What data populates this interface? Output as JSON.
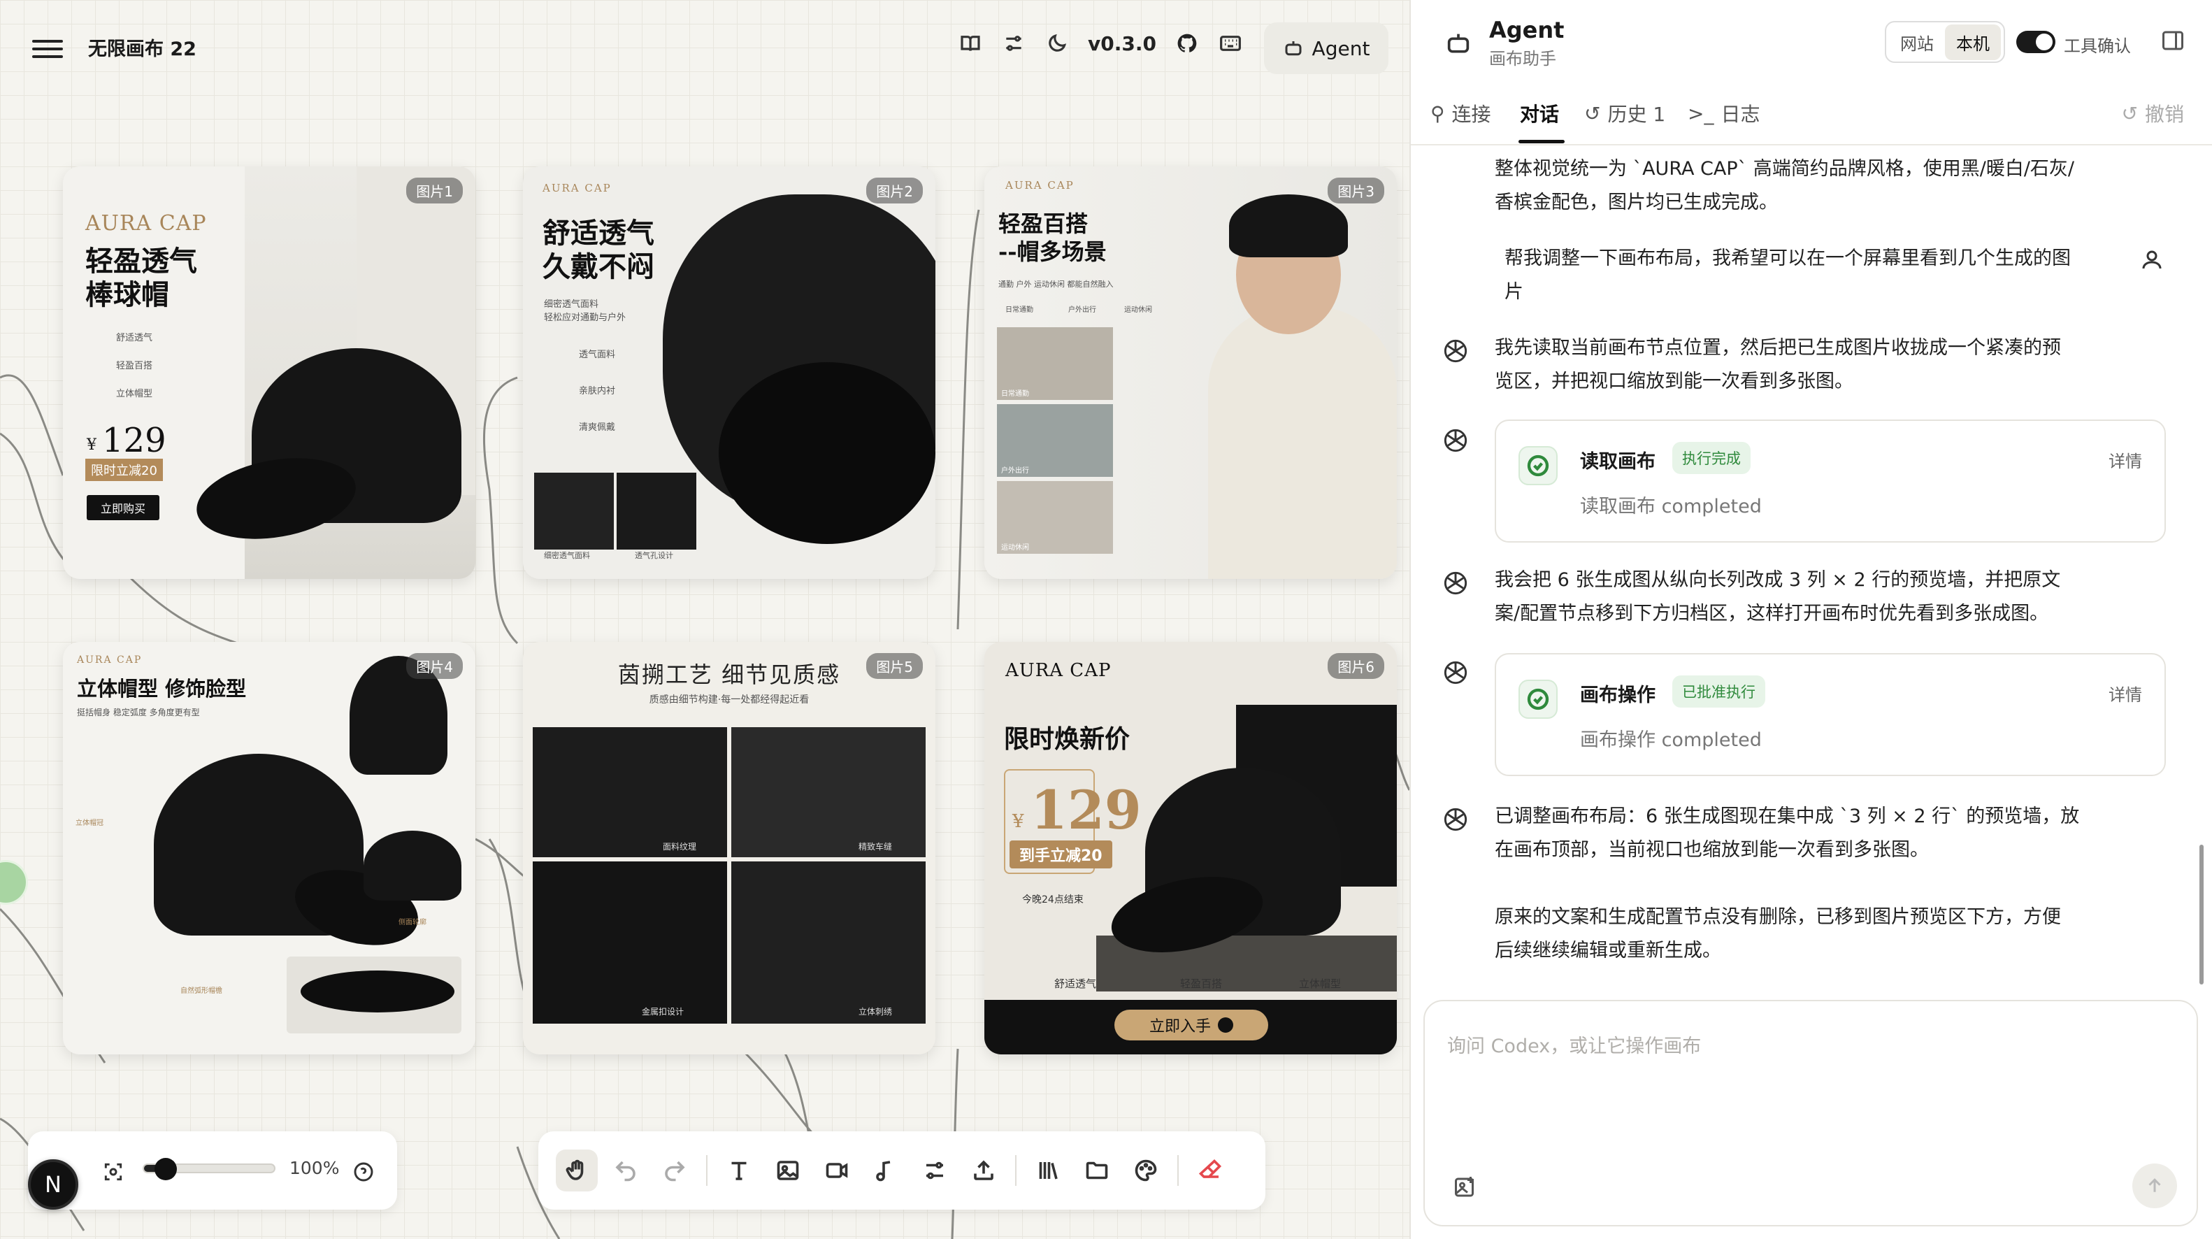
{
  "canvas": {
    "title": "无限画布 22",
    "version": "v0.3.0",
    "agent_button": "Agent",
    "zoom": "100%",
    "zoom_level": 0.12,
    "user_initial": "N"
  },
  "topbar_icons": [
    "docs-icon",
    "settings-icon",
    "theme-moon-icon",
    "github-icon",
    "keyboard-icon"
  ],
  "cards": [
    {
      "badge": "图片1",
      "brand": "AURA CAP",
      "headline": "轻盈透气\n棒球帽",
      "features": [
        "舒适透气",
        "轻盈百搭",
        "立体帽型"
      ],
      "price_symbol": "¥",
      "price": "129",
      "promo": "限时立减20",
      "cta": "立即购买"
    },
    {
      "badge": "图片2",
      "brand": "AURA CAP",
      "headline": "舒适透气\n久戴不闷",
      "sub": "细密透气面料\n轻松应对通勤与户外",
      "features": [
        "透气面料",
        "亲肤内衬",
        "清爽佩戴"
      ],
      "captions": [
        "细密透气面料",
        "透气孔设计"
      ]
    },
    {
      "badge": "图片3",
      "brand": "AURA CAP",
      "headline": "轻盈百搭\n--帽多场景",
      "sub": "通勤 户外 运动休闲 都能自然融入",
      "tags": [
        "日常通勤",
        "户外出行",
        "运动休闲"
      ],
      "scenes": [
        "日常通勤",
        "户外出行",
        "运动休闲"
      ]
    },
    {
      "badge": "图片4",
      "brand": "AURA CAP",
      "headline": "立体帽型 修饰脸型",
      "sub": "挺括帽身 稳定弧度 多角度更有型",
      "callouts": [
        "立体帽冠",
        "侧面轮廓",
        "自然弧形帽檐"
      ]
    },
    {
      "badge": "图片5",
      "headline": "茵搠工艺 细节见质感",
      "sub": "质感由细节构建·每一处都经得起近看",
      "captions": [
        "面料纹理",
        "精致车缝",
        "金属扣设计",
        "立体刺绣"
      ]
    },
    {
      "badge": "图片6",
      "brand": "AURA CAP",
      "headline": "限时焕新价",
      "price_symbol": "¥",
      "price": "129",
      "promo": "到手立减20",
      "timer": "今晚24点结束",
      "features": [
        "舒适透气",
        "轻盈百搭",
        "立体帽型"
      ],
      "cta": "立即入手"
    }
  ],
  "panel": {
    "title": "Agent",
    "subtitle": "画布助手",
    "seg_options": [
      "网站",
      "本机"
    ],
    "seg_selected": "本机",
    "tool_confirm": "工具确认",
    "tool_confirm_on": true,
    "tabs": [
      "连接",
      "对话",
      "历史 1",
      "日志"
    ],
    "active_tab": "对话",
    "undo": "撤销",
    "messages": [
      {
        "role": "assistant",
        "text": "整体视觉统一为 `AURA CAP` 高端简约品牌风格，使用黑/暖白/石灰/\n香槟金配色，图片均已生成完成。"
      },
      {
        "role": "user",
        "text": "帮我调整一下画布布局，我希望可以在一个屏幕里看到几个生成的图\n片"
      },
      {
        "role": "assistant",
        "text": "我先读取当前画布节点位置，然后把已生成图片收拢成一个紧凑的预\n览区，并把视口缩放到能一次看到多张图。"
      },
      {
        "role": "tool",
        "name": "读取画布",
        "status": "执行完成",
        "detail": "详情",
        "desc": "读取画布 completed"
      },
      {
        "role": "assistant",
        "text": "我会把 6 张生成图从纵向长列改成 3 列 × 2 行的预览墙，并把原文\n案/配置节点移到下方归档区，这样打开画布时优先看到多张成图。"
      },
      {
        "role": "tool",
        "name": "画布操作",
        "status": "已批准执行",
        "detail": "详情",
        "desc": "画布操作 completed"
      },
      {
        "role": "assistant",
        "text": "已调整画布布局：6 张生成图现在集中成 `3 列 × 2 行` 的预览墙，放\n在画布顶部，当前视口也缩放到能一次看到多张图。\n\n原来的文案和生成配置节点没有删除，已移到图片预览区下方，方便\n后续继续编辑或重新生成。"
      }
    ],
    "input_placeholder": "询问 Codex，或让它操作画布"
  },
  "toolbar": [
    "hand-icon",
    "undo-icon",
    "redo-icon",
    "text-icon",
    "image-icon",
    "video-icon",
    "audio-icon",
    "settings-icon",
    "upload-icon",
    "library-icon",
    "folder-icon",
    "palette-icon",
    "eraser-icon"
  ]
}
